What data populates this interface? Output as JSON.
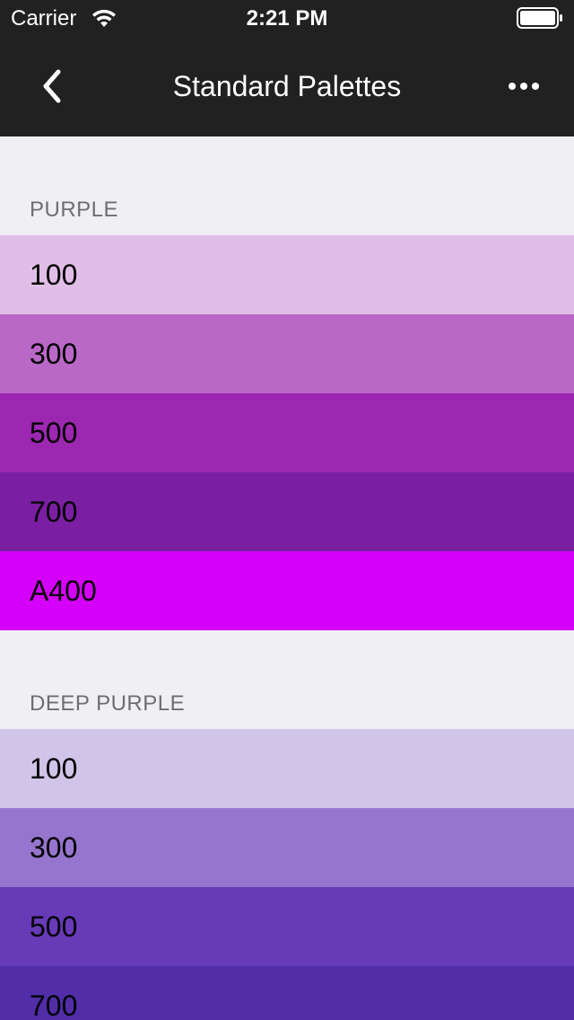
{
  "status_bar": {
    "carrier": "Carrier",
    "time": "2:21 PM"
  },
  "nav": {
    "title": "Standard Palettes",
    "back_icon": "chevron-left-icon",
    "more_icon": "more-horizontal-icon"
  },
  "sections": [
    {
      "title": "PURPLE",
      "swatches": [
        {
          "label": "100",
          "color": "#e1bee7"
        },
        {
          "label": "300",
          "color": "#ba68c8"
        },
        {
          "label": "500",
          "color": "#9c27b0"
        },
        {
          "label": "700",
          "color": "#7b1fa2"
        },
        {
          "label": "A400",
          "color": "#d500f9"
        }
      ]
    },
    {
      "title": "DEEP PURPLE",
      "swatches": [
        {
          "label": "100",
          "color": "#d1c4e9"
        },
        {
          "label": "300",
          "color": "#9575cd"
        },
        {
          "label": "500",
          "color": "#673ab7"
        },
        {
          "label": "700",
          "color": "#512da8"
        }
      ]
    }
  ],
  "colors": {
    "nav_background": "#212121",
    "page_background": "#efeff4",
    "section_header_text": "#6d6d72"
  }
}
